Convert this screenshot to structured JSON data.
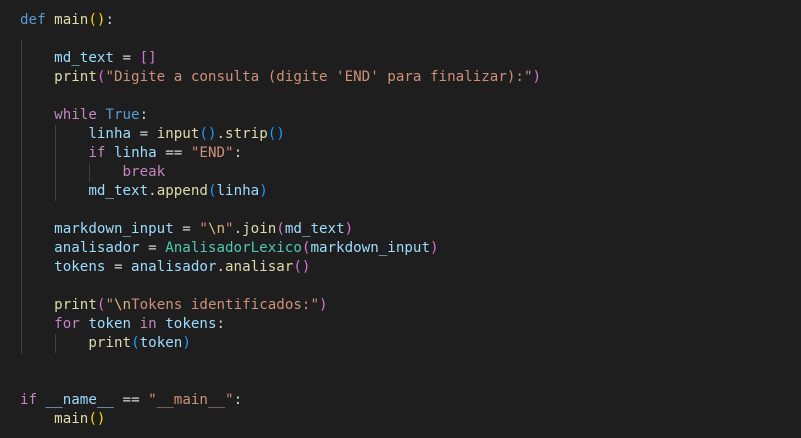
{
  "code": {
    "l1": {
      "kw": "def",
      "name": "main",
      "p_open": "(",
      "p_close": ")",
      "colon": ":"
    },
    "l3": {
      "var": "md_text",
      "eq": " = ",
      "b_open": "[",
      "b_close": "]"
    },
    "l4": {
      "fn": "print",
      "p_open": "(",
      "str": "\"Digite a consulta (digite 'END' para finalizar):\"",
      "p_close": ")"
    },
    "l6": {
      "kw": "while",
      "const": "True",
      "colon": ":"
    },
    "l7": {
      "var": "linha",
      "eq": " = ",
      "fn1": "input",
      "p1_open": "(",
      "p1_close": ")",
      "dot": ".",
      "fn2": "strip",
      "p2_open": "(",
      "p2_close": ")"
    },
    "l8": {
      "kw": "if",
      "var": "linha",
      "eq": " == ",
      "str": "\"END\"",
      "colon": ":"
    },
    "l9": {
      "kw": "break"
    },
    "l10": {
      "var": "md_text",
      "dot": ".",
      "fn": "append",
      "p_open": "(",
      "arg": "linha",
      "p_close": ")"
    },
    "l12": {
      "var": "markdown_input",
      "eq": " = ",
      "str_q1": "\"",
      "esc": "\\n",
      "str_q2": "\"",
      "dot": ".",
      "fn": "join",
      "p_open": "(",
      "arg": "md_text",
      "p_close": ")"
    },
    "l13": {
      "var": "analisador",
      "eq": " = ",
      "cls": "AnalisadorLexico",
      "p_open": "(",
      "arg": "markdown_input",
      "p_close": ")"
    },
    "l14": {
      "var": "tokens",
      "eq": " = ",
      "obj": "analisador",
      "dot": ".",
      "fn": "analisar",
      "p_open": "(",
      "p_close": ")"
    },
    "l16": {
      "fn": "print",
      "p_open": "(",
      "str_q1": "\"",
      "esc": "\\n",
      "str_rest": "Tokens identificados:\"",
      "p_close": ")"
    },
    "l17": {
      "kw1": "for",
      "var1": "token",
      "kw2": "in",
      "var2": "tokens",
      "colon": ":"
    },
    "l18": {
      "fn": "print",
      "p_open": "(",
      "arg": "token",
      "p_close": ")"
    },
    "l21": {
      "kw": "if",
      "var": "__name__",
      "eq": " == ",
      "str": "\"__main__\"",
      "colon": ":"
    },
    "l22": {
      "fn": "main",
      "p_open": "(",
      "p_close": ")"
    }
  }
}
